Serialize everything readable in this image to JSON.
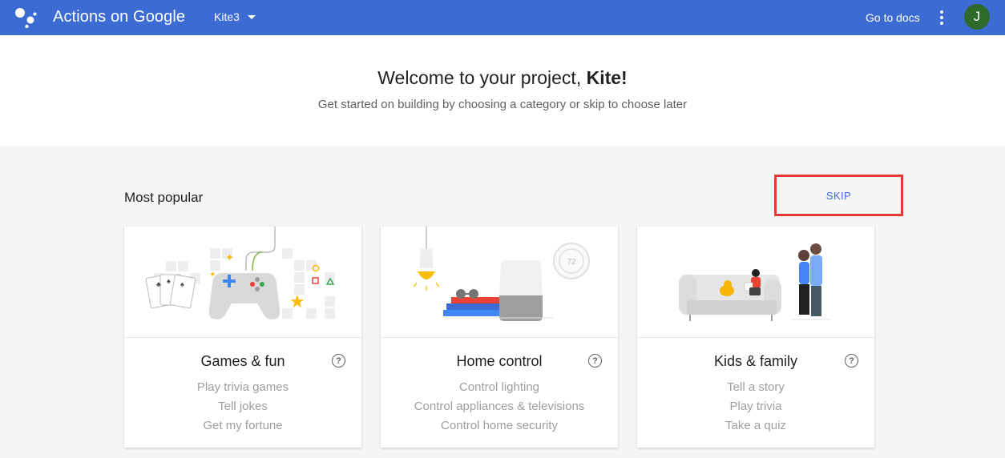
{
  "topbar": {
    "app_title": "Actions on Google",
    "project_name": "Kite3",
    "docs_label": "Go to docs",
    "avatar_initial": "J",
    "bar_color": "#3c6bd3"
  },
  "welcome": {
    "title_prefix": "Welcome to your project, ",
    "title_name": "Kite!",
    "subtitle": "Get started on building by choosing a category or skip to choose later"
  },
  "section": {
    "title": "Most popular",
    "skip_label": "SKIP"
  },
  "cards": [
    {
      "title": "Games & fun",
      "help": "?",
      "examples": [
        "Play trivia games",
        "Tell jokes",
        "Get my fortune"
      ]
    },
    {
      "title": "Home control",
      "help": "?",
      "examples": [
        "Control lighting",
        "Control appliances & televisions",
        "Control home security"
      ]
    },
    {
      "title": "Kids & family",
      "help": "?",
      "examples": [
        "Tell a story",
        "Play trivia",
        "Take a quiz"
      ]
    }
  ],
  "illustration_numbers": {
    "thermostat": "72"
  }
}
